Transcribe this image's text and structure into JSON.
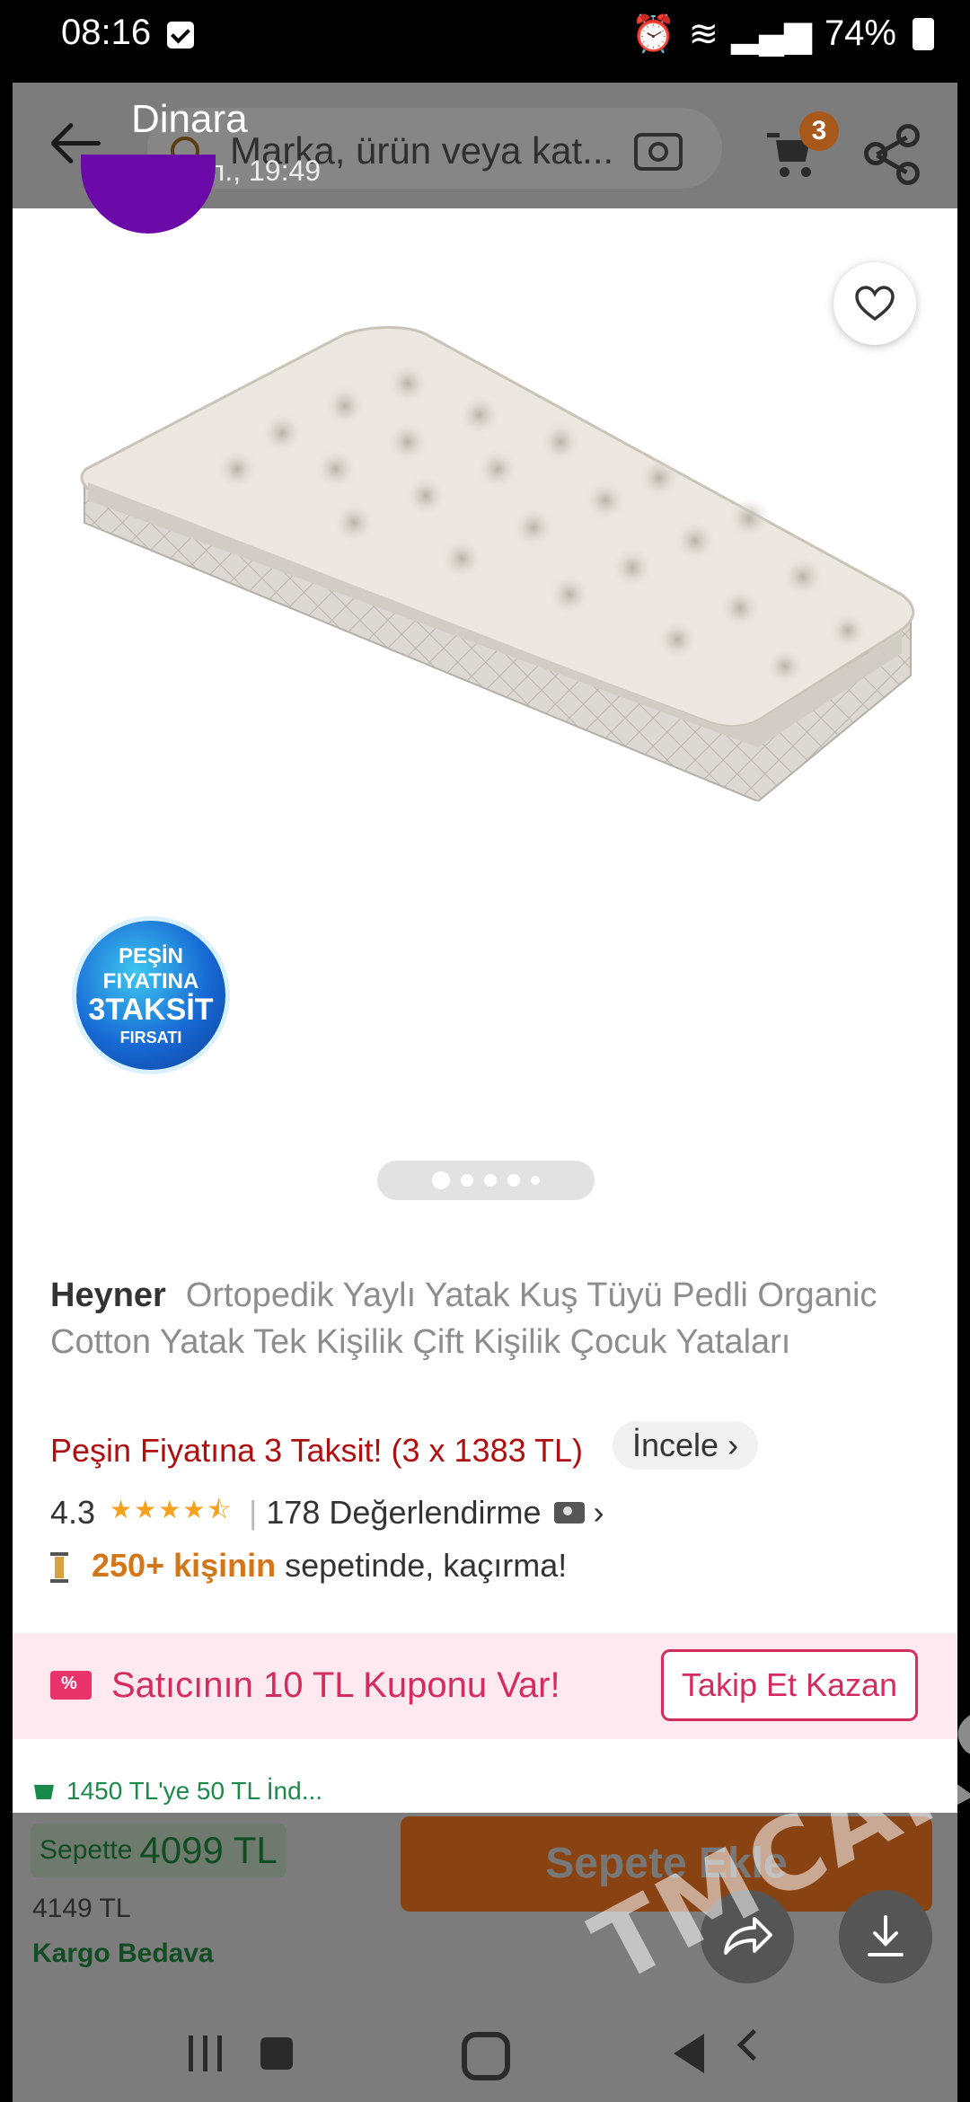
{
  "status_bar": {
    "time": "08:16",
    "battery": "74%"
  },
  "chat_overlay": {
    "sender": "Dinara",
    "timestamp": "24 июл., 19:49"
  },
  "header": {
    "search_placeholder": "Marka, ürün veya kat...",
    "cart_count": "3"
  },
  "gallery": {
    "badge_lines": [
      "PEŞİN",
      "FIYATINA",
      "3TAKSİT",
      "FIRSATI"
    ],
    "image_count": 5,
    "active_index": 0
  },
  "product": {
    "brand": "Heyner",
    "title": "Ortopedik Yaylı Yatak Kuş Tüyü Pedli Organic Cotton Yatak Tek Kişilik Çift Kişilik Çocuk Yataları",
    "installment_text": "Peşin Fiyatına 3 Taksit! (3 x 1383 TL)",
    "installment_link": "İncele",
    "rating": "4.3",
    "rating_stars": 4.3,
    "reviews": "178 Değerlendirme",
    "basket_highlight": "250+ kişinin",
    "basket_rest": "sepetinde, kaçırma!"
  },
  "coupon": {
    "text": "Satıcının 10 TL Kuponu Var!",
    "button": "Takip Et Kazan"
  },
  "shipping_promo": "1450 TL'ye 50 TL İnd...",
  "purchase": {
    "sepette_label": "Sepette",
    "sepette_price": "4099 TL",
    "old_price": "4149 TL",
    "kargo": "Kargo Bedava",
    "add_button": "Sepete Ekle"
  },
  "watermark": "TMCARS",
  "colors": {
    "accent_orange": "#f27a1a",
    "coupon_pink": "#d42c5f",
    "green": "#1a8a4a",
    "installment_red": "#b00f0f"
  }
}
